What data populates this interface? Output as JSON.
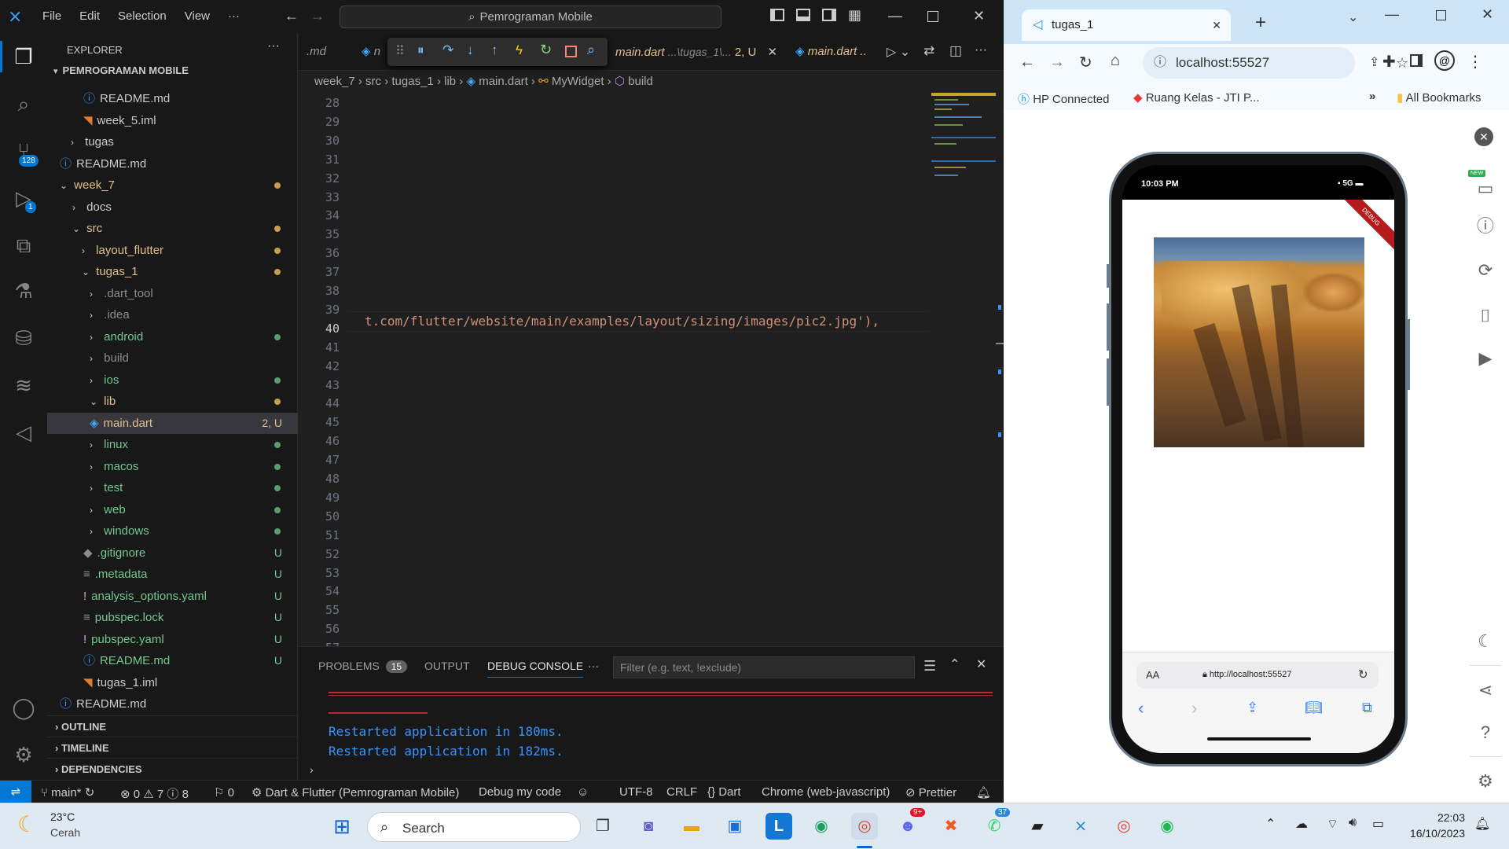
{
  "vscode": {
    "menu": [
      "File",
      "Edit",
      "Selection",
      "View",
      "···"
    ],
    "command_center": "Pemrograman Mobile",
    "activity_badges": {
      "source_control": "128",
      "run_debug": "1"
    },
    "explorer": {
      "title": "EXPLORER",
      "workspace": "PEMROGRAMAN MOBILE",
      "tree": [
        {
          "label": "README.md",
          "icon": "info-icon"
        },
        {
          "label": "week_5.iml",
          "icon": "rss-icon"
        },
        {
          "label": "tugas",
          "folder": true
        },
        {
          "label": "README.md",
          "icon": "info-icon"
        },
        {
          "label": "week_7",
          "folder": true,
          "open": true
        },
        {
          "label": "docs",
          "folder": true
        },
        {
          "label": "src",
          "folder": true,
          "open": true
        },
        {
          "label": "layout_flutter",
          "folder": true
        },
        {
          "label": "tugas_1",
          "folder": true,
          "open": true
        },
        {
          "label": ".dart_tool",
          "folder": true
        },
        {
          "label": ".idea",
          "folder": true
        },
        {
          "label": "android",
          "folder": true
        },
        {
          "label": "build",
          "folder": true
        },
        {
          "label": "ios",
          "folder": true
        },
        {
          "label": "lib",
          "folder": true,
          "open": true
        },
        {
          "label": "main.dart",
          "icon": "dart-icon",
          "status": "2, U"
        },
        {
          "label": "linux",
          "folder": true
        },
        {
          "label": "macos",
          "folder": true
        },
        {
          "label": "test",
          "folder": true
        },
        {
          "label": "web",
          "folder": true
        },
        {
          "label": "windows",
          "folder": true
        },
        {
          "label": ".gitignore",
          "status": "U"
        },
        {
          "label": ".metadata",
          "status": "U"
        },
        {
          "label": "analysis_options.yaml",
          "status": "U"
        },
        {
          "label": "pubspec.lock",
          "status": "U"
        },
        {
          "label": "pubspec.yaml",
          "status": "U"
        },
        {
          "label": "README.md",
          "status": "U"
        },
        {
          "label": "tugas_1.iml"
        },
        {
          "label": "README.md"
        }
      ],
      "sections": [
        "OUTLINE",
        "TIMELINE",
        "DEPENDENCIES"
      ]
    },
    "tabs": [
      ".md",
      "n",
      "main.dart",
      "...\\tugas_1\\...",
      "2, U",
      "main.dart",
      ".."
    ],
    "breadcrumb": [
      "week_7",
      "src",
      "tugas_1",
      "lib",
      "main.dart",
      "MyWidget",
      "build"
    ],
    "line_numbers": [
      "28",
      "29",
      "30",
      "31",
      "32",
      "33",
      "34",
      "35",
      "36",
      "37",
      "38",
      "39",
      "40",
      "41",
      "42",
      "43",
      "44",
      "45",
      "46",
      "47",
      "48",
      "49",
      "50",
      "51",
      "52",
      "53",
      "54",
      "55",
      "56",
      "57"
    ],
    "code_line_40": "t.com/flutter/website/main/examples/layout/sizing/images/pic2.jpg'),",
    "panel": {
      "tabs": [
        "PROBLEMS",
        "OUTPUT",
        "DEBUG CONSOLE",
        "···"
      ],
      "problems_count": "15",
      "filter_placeholder": "Filter (e.g. text, !exclude)",
      "console": [
        "Restarted application in 180ms.",
        "Restarted application in 182ms."
      ]
    },
    "status": {
      "branch": "main*",
      "errors": "0",
      "warnings": "7",
      "info": "8",
      "ports": "0",
      "launch": "Dart & Flutter (Pemrograman Mobile)",
      "debug_my_code": "Debug my code",
      "encoding": "UTF-8",
      "eol": "CRLF",
      "language": "Dart",
      "device": "Chrome (web-javascript)",
      "prettier": "Prettier"
    }
  },
  "chrome": {
    "tab_title": "tugas_1",
    "url": "localhost:55527",
    "bookmarks": [
      "HP Connected",
      "Ruang Kelas - JTI P...",
      "»",
      "All Bookmarks"
    ],
    "device_time": "10:03 PM",
    "network": "5G",
    "debug_banner": "DEBUG",
    "phone_url_aa": "AA",
    "phone_url": "http://localhost:55527",
    "devtools_new_badge": "NEW"
  },
  "taskbar": {
    "weather_temp": "23°C",
    "weather_desc": "Cerah",
    "search": "Search",
    "discord_badge": "9+",
    "whatsapp_badge": "37",
    "time": "22:03",
    "date": "16/10/2023"
  }
}
